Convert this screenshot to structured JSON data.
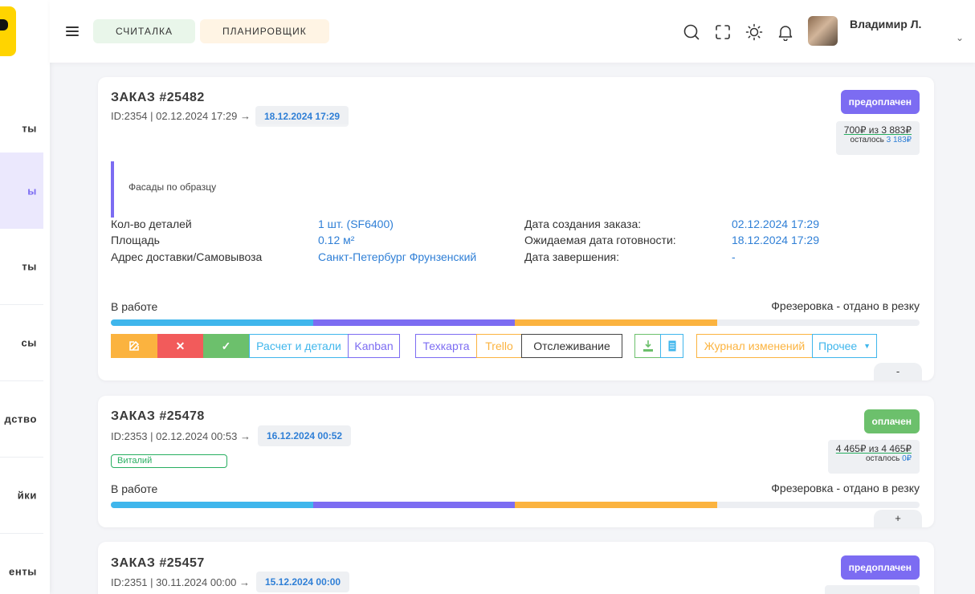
{
  "sidebar": {
    "items": [
      {
        "label": "ты"
      },
      {
        "label": "ы"
      },
      {
        "label": "ты"
      },
      {
        "label": "сы"
      },
      {
        "label": "дство"
      },
      {
        "label": "йки"
      },
      {
        "label": "енты"
      }
    ],
    "active_index": 1
  },
  "topbar": {
    "btn_calc": "СЧИТАЛКА",
    "btn_planner": "ПЛАНИРОВЩИК",
    "icons": [
      "menu-icon",
      "search-icon",
      "fullscreen-icon",
      "sun-icon",
      "bell-icon",
      "chevron-down-icon"
    ],
    "user_name": "Владимир Л."
  },
  "colors": {
    "accent": "#7c6cf2",
    "link": "#2f7fd6",
    "green": "#6cc06c",
    "red": "#f25b5b",
    "orange": "#fbb33f",
    "progress_blue": "#3fb6ec",
    "progress_purple": "#7c6cf2",
    "progress_orange": "#fbb33f"
  },
  "orders": [
    {
      "title": "ЗАКАЗ #25482",
      "meta": "ID:2354 | 02.12.2024 17:29 →",
      "due": "18.12.2024 17:29",
      "status_badge": "предоплачен",
      "price_line": "700₽ из 3 883₽",
      "remain_label": "осталось",
      "remain_value": "3 183₽",
      "note": "Фасады по образцу",
      "info": {
        "details_label": "Кол-во деталей",
        "details_value": "1 шт. (SF6400)",
        "area_label": "Площадь",
        "area_value": "0.12 м²",
        "address_label": "Адрес доставки/Самовывоза",
        "address_value": "Санкт-Петербург Фрунзенский",
        "created_label": "Дата создания заказа:",
        "created_value": "02.12.2024 17:29",
        "expected_label": "Ожидаемая дата готовности:",
        "expected_value": "18.12.2024 17:29",
        "finished_label": "Дата завершения:",
        "finished_value": "-"
      },
      "status_text": "В работе",
      "stage_text": "Фрезеровка - отдано в резку",
      "progress_stages": 3,
      "actions": {
        "calc_details": "Расчет и детали",
        "kanban": "Kanban",
        "techcard": "Техкарта",
        "trello": "Trello",
        "tracking": "Отслеживание",
        "changelog": "Журнал изменений",
        "other": "Прочее"
      },
      "collapse_symbol": "-"
    },
    {
      "title": "ЗАКАЗ #25478",
      "meta": "ID:2353 | 02.12.2024 00:53 →",
      "due": "16.12.2024 00:52",
      "person": "Виталий",
      "status_badge": "оплачен",
      "price_line": "4 465₽ из 4 465₽",
      "remain_label": "осталось",
      "remain_value": "0₽",
      "status_text": "В работе",
      "stage_text": "Фрезеровка - отдано в резку",
      "progress_stages": 3,
      "collapse_symbol": "+"
    },
    {
      "title": "ЗАКАЗ #25457",
      "meta": "ID:2351 | 30.11.2024 00:00 →",
      "due": "15.12.2024 00:00",
      "status_badge": "предоплачен"
    }
  ]
}
